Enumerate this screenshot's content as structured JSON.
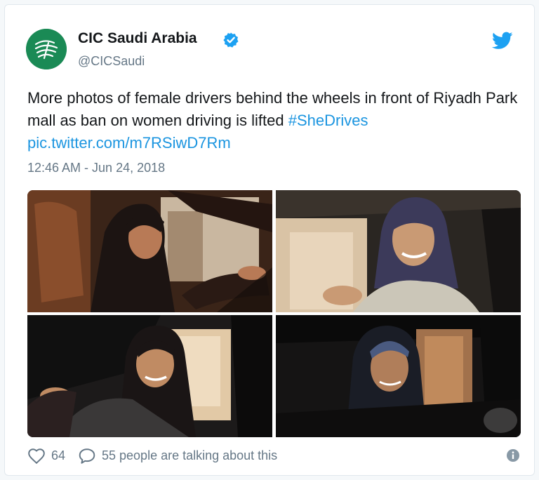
{
  "account": {
    "name": "CIC Saudi Arabia",
    "handle": "@CICSaudi",
    "avatar_icon": "cic-logo-icon",
    "verified_icon": "verified-badge-icon",
    "brand_color": "#1a8a55",
    "verified_color": "#1da1f2"
  },
  "tweet": {
    "text_before": "More photos of female drivers behind the wheels in front of Riyadh Park mall as ban on women driving is lifted ",
    "hashtag": "#SheDrives",
    "pic_link": "pic.twitter.com/m7RSiwD7Rm",
    "timestamp": "12:46 AM - Jun 24, 2018",
    "link_color": "#1b95e0"
  },
  "photos": [
    {
      "desc_icon": "photo-woman-driving-1"
    },
    {
      "desc_icon": "photo-woman-driving-2"
    },
    {
      "desc_icon": "photo-woman-driving-3"
    },
    {
      "desc_icon": "photo-woman-driving-4"
    }
  ],
  "footer": {
    "likes": "64",
    "talking": "55 people are talking about this",
    "heart_icon": "heart-icon",
    "reply_icon": "comment-icon",
    "info_icon": "info-icon"
  },
  "twitter_icon": "twitter-bird-icon"
}
